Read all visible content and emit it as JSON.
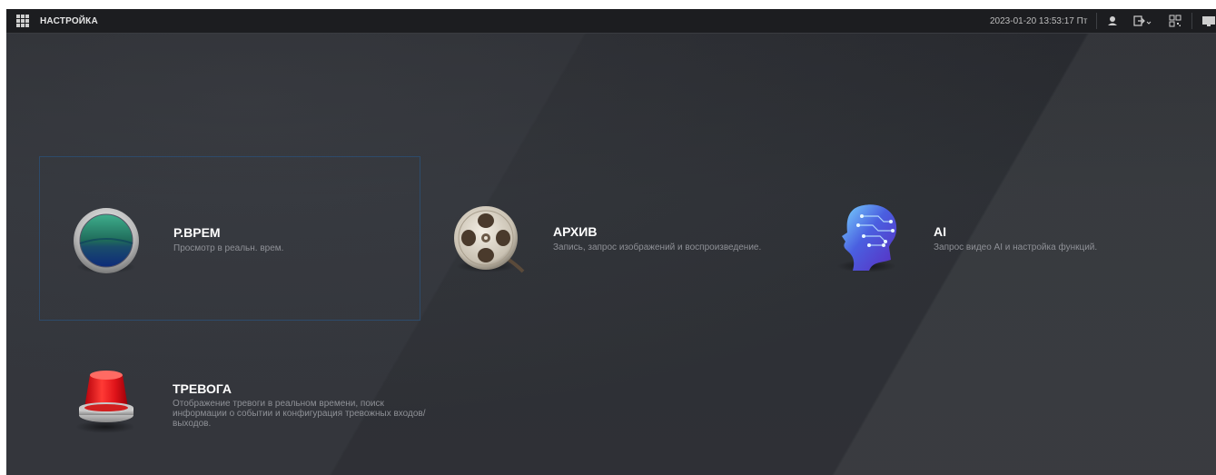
{
  "topbar": {
    "title": "НАСТРОЙКА",
    "datetime": "2023-01-20 13:53:17 Пт",
    "icons": [
      "menu-grid-icon",
      "user-icon",
      "logout-icon",
      "qr-code-icon",
      "monitor-icon"
    ]
  },
  "tiles": [
    {
      "id": "live",
      "title": "Р.ВРЕМ",
      "desc": "Просмотр в реальн. врем.",
      "icon": "live-view-icon",
      "selected": true
    },
    {
      "id": "archive",
      "title": "АРХИВ",
      "desc": "Запись, запрос изображений и воспроизведение.",
      "icon": "film-reel-icon",
      "selected": false
    },
    {
      "id": "ai",
      "title": "AI",
      "desc": "Запрос видео AI и настройка функций.",
      "icon": "ai-head-icon",
      "selected": false
    },
    {
      "id": "alarm",
      "title": "ТРЕВОГА",
      "desc": "Отображение тревоги в реальном времени, поиск информации о событии и конфигурация тревожных входов/выходов.",
      "icon": "alarm-light-icon",
      "selected": false
    }
  ],
  "colors": {
    "topbar_bg": "#1c1d20",
    "background": "#32353b",
    "selection_border": "#2d4b6b",
    "title_text": "#ffffff",
    "desc_text": "#8e9096"
  }
}
